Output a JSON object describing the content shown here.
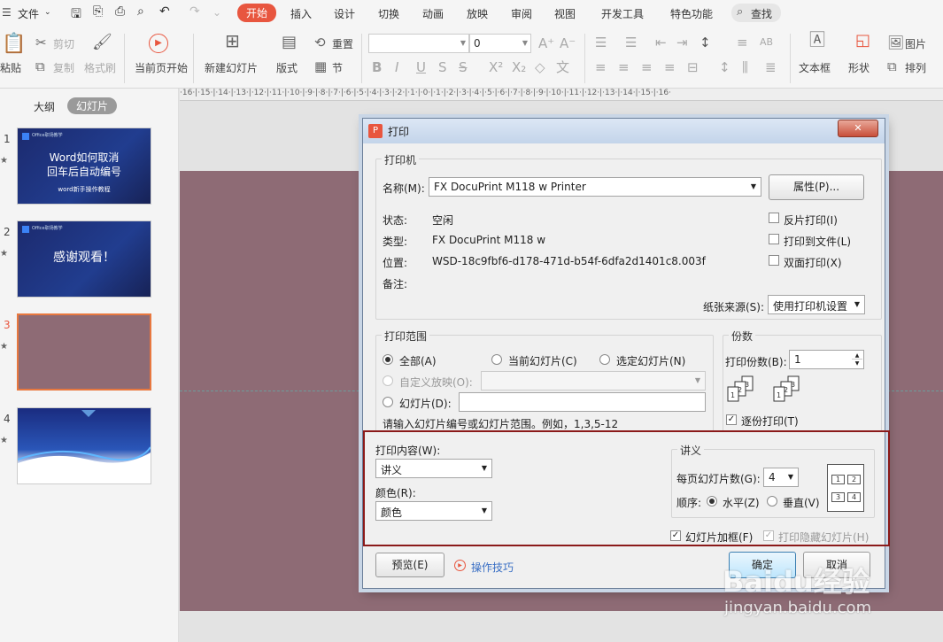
{
  "menu": {
    "file": "文件",
    "tabs": [
      "开始",
      "插入",
      "设计",
      "切换",
      "动画",
      "放映",
      "审阅",
      "视图",
      "开发工具",
      "特色功能"
    ],
    "search": "查找"
  },
  "ribbon": {
    "paste": "粘贴",
    "cut": "剪切",
    "copy": "复制",
    "format_painter": "格式刷",
    "play_from_current": "当前页开始",
    "new_slide": "新建幻灯片",
    "layout": "版式",
    "reset": "重置",
    "section": "节",
    "font_size": "0",
    "textbox": "文本框",
    "shape": "形状",
    "picture": "图片",
    "arrange": "排列"
  },
  "panel": {
    "tab_outline": "大纲",
    "tab_slides": "幻灯片",
    "slides": [
      {
        "num": "1",
        "brand": "Office职场教学",
        "title1": "Word如何取消",
        "title2": "回车后自动编号",
        "sub": "word新手操作教程"
      },
      {
        "num": "2",
        "brand": "Office职场教学",
        "title1": "感谢观看！"
      },
      {
        "num": "3"
      },
      {
        "num": "4"
      }
    ]
  },
  "ruler": "·16·|·15·|·14·|·13·|·12·|·11·|·10·|·9·|·8·|·7·|·6·|·5·|·4·|·3·|·2·|·1·|·0·|·1·|·2·|·3·|·4·|·5·|·6·|·7·|·8·|·9·|·10·|·11·|·12·|·13·|·14·|·15·|·16·",
  "dialog": {
    "title": "打印",
    "close": "✕",
    "printer": {
      "group": "打印机",
      "name_label": "名称(M):",
      "name_value": "FX DocuPrint M118 w Printer",
      "properties": "属性(P)...",
      "status_label": "状态:",
      "status_value": "空闲",
      "type_label": "类型:",
      "type_value": "FX DocuPrint M118 w",
      "location_label": "位置:",
      "location_value": "WSD-18c9fbf6-d178-471d-b54f-6dfa2d1401c8.003f",
      "comment_label": "备注:",
      "reverse": "反片打印(I)",
      "to_file": "打印到文件(L)",
      "duplex": "双面打印(X)",
      "paper_source_label": "纸张来源(S):",
      "paper_source_value": "使用打印机设置"
    },
    "range": {
      "group": "打印范围",
      "all": "全部(A)",
      "current": "当前幻灯片(C)",
      "selected": "选定幻灯片(N)",
      "custom": "自定义放映(O):",
      "slides": "幻灯片(D):",
      "hint": "请输入幻灯片编号或幻灯片范围。例如，1,3,5-12"
    },
    "copies": {
      "group": "份数",
      "label": "打印份数(B):",
      "value": "1",
      "collate": "逐份打印(T)"
    },
    "content": {
      "label": "打印内容(W):",
      "value": "讲义",
      "color_label": "颜色(R):",
      "color_value": "颜色"
    },
    "handout": {
      "group": "讲义",
      "per_page_label": "每页幻灯片数(G):",
      "per_page_value": "4",
      "order_label": "顺序:",
      "horizontal": "水平(Z)",
      "vertical": "垂直(V)",
      "cells": [
        "1",
        "2",
        "3",
        "4"
      ]
    },
    "frame": "幻灯片加框(F)",
    "print_hidden": "打印隐藏幻灯片(H)",
    "preview": "预览(E)",
    "tips": "操作技巧",
    "ok": "确定",
    "cancel": "取消"
  },
  "watermark": {
    "brand": "Baidu经验",
    "url": "jingyan.baidu.com"
  }
}
